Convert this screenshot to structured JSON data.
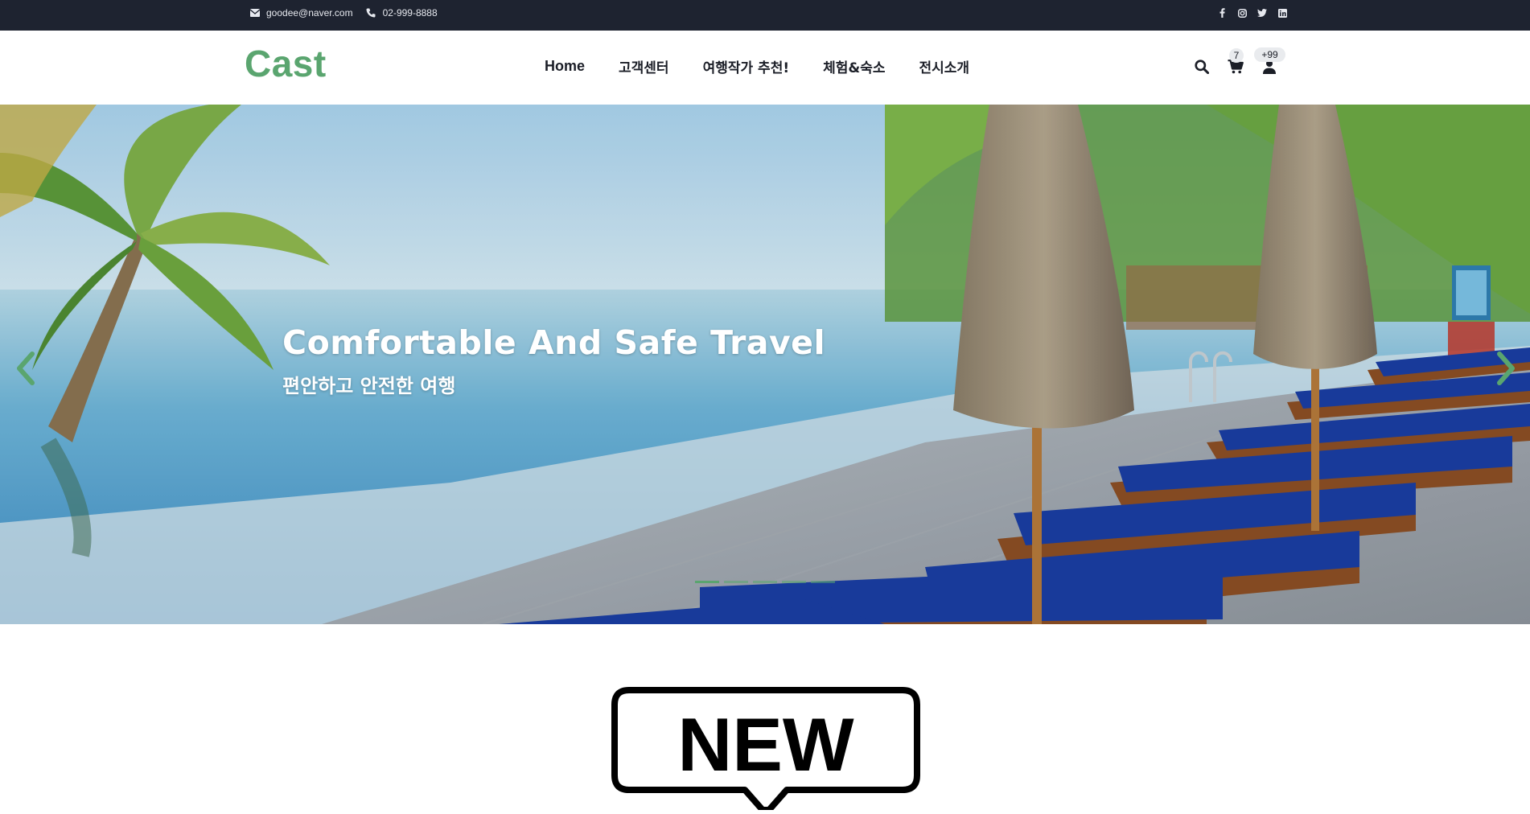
{
  "topbar": {
    "email": "goodee@naver.com",
    "phone": "02-999-8888",
    "email_icon": "envelope-icon",
    "phone_icon": "phone-icon",
    "social": [
      "facebook-icon",
      "instagram-icon",
      "twitter-icon",
      "linkedin-icon"
    ]
  },
  "header": {
    "logo": "Cast",
    "nav": [
      "Home",
      "고객센터",
      "여행작가 추천!",
      "체험&숙소",
      "전시소개"
    ],
    "cart_count": "7",
    "user_count": "+99"
  },
  "hero": {
    "title": "Comfortable And Safe Travel",
    "subtitle": "편안하고 안전한 여행",
    "slide_count": 5,
    "active_slide": 1
  },
  "new_section": {
    "label": "NEW"
  },
  "colors": {
    "accent": "#5aa56f",
    "topbar_bg": "#1e2330",
    "text_dark": "#1b1e27"
  }
}
